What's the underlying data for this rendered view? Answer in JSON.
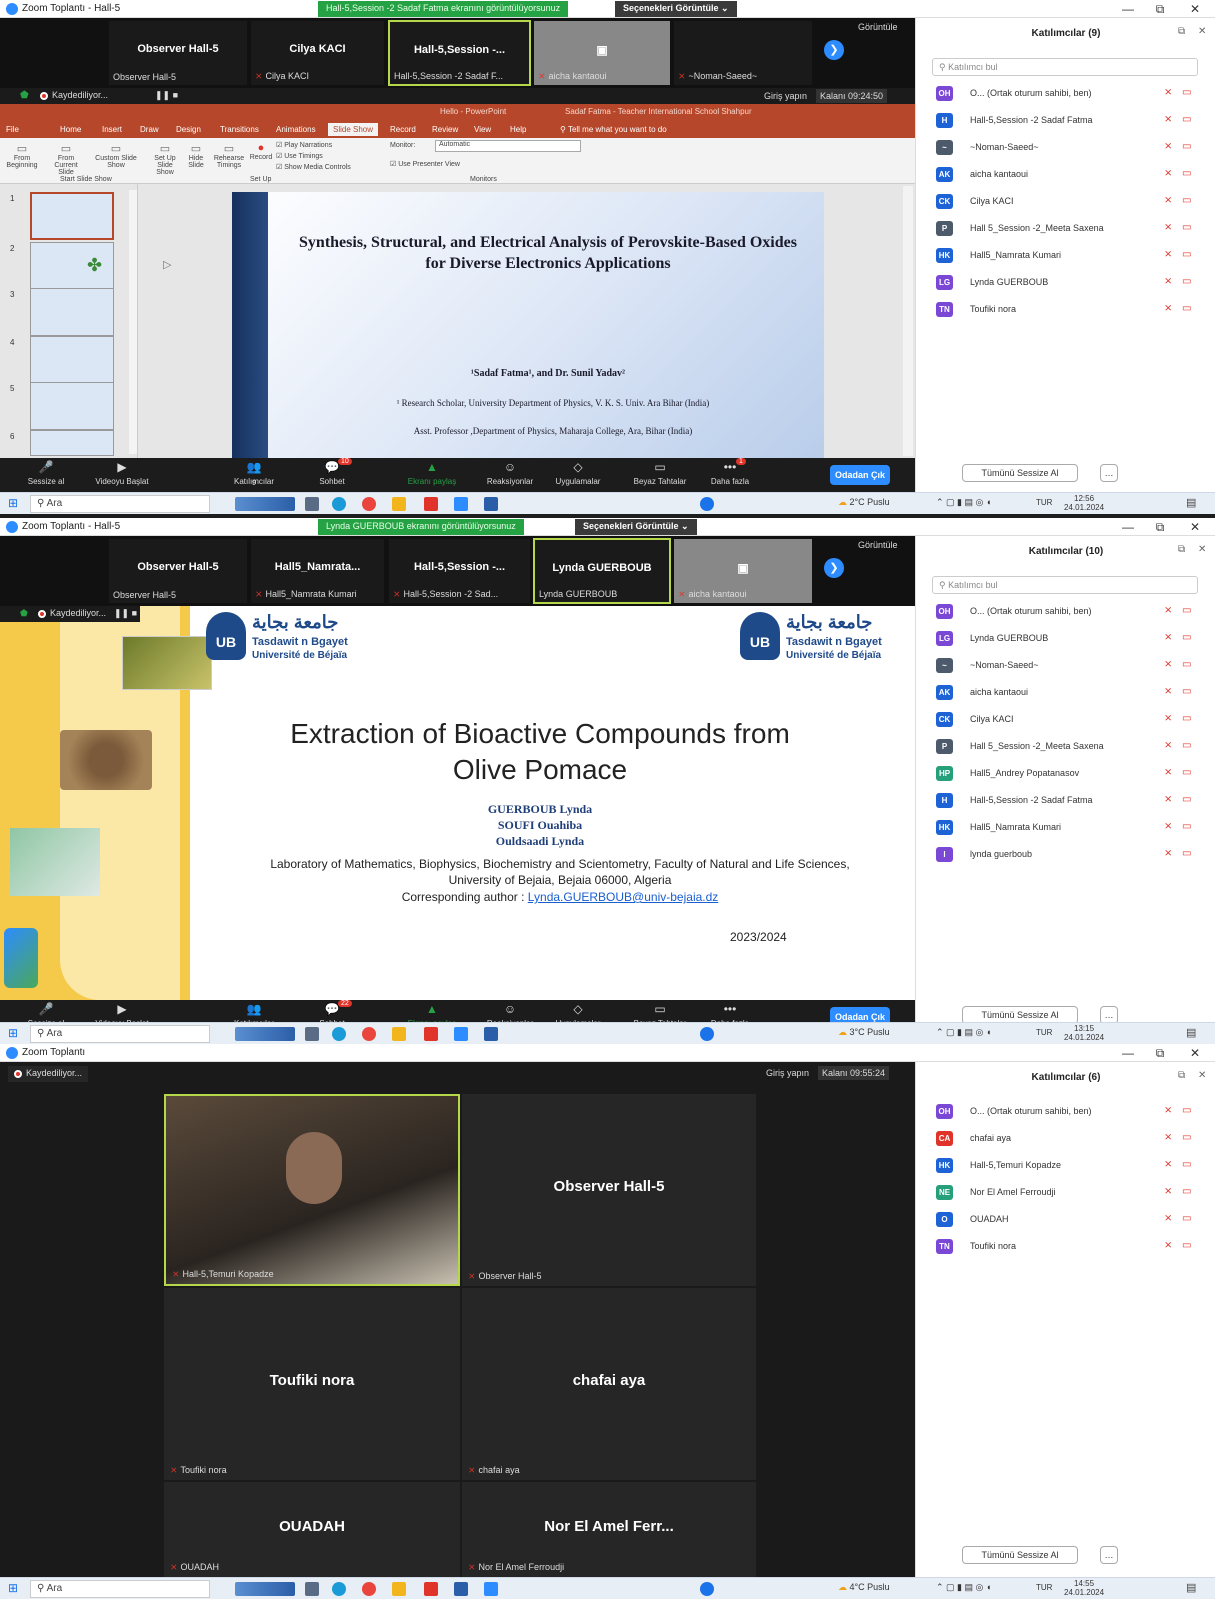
{
  "common": {
    "minimize": "—",
    "restore": "⧉",
    "close": "✕",
    "view_label": "Görüntüle",
    "next_arrow": "❯",
    "mic_off": "🎙̸",
    "options": "Seçenekleri Görüntüle  ⌄",
    "mute_all": "Tümünü Sessize Al",
    "more": "…",
    "search_placeholder": "Katılımcı bul",
    "search_icon": "search-icon",
    "sign_in": "Giriş yapın",
    "taskbar_search": "Ara",
    "lang": "TUR",
    "leave": "Odadan Çık",
    "colors": {
      "zoom_blue": "#2d8cff",
      "share_green": "#25a244",
      "rec_red": "#e0342a",
      "ppt_orange": "#b7472a",
      "active_border": "#b4d84a"
    }
  },
  "toolbar": {
    "mute1": "Sessize al",
    "mute2": "Sessize al",
    "video": "Videoyu Başlat",
    "participants": "Katılımcılar",
    "chat": "Sohbet",
    "share": "Ekranı paylaş",
    "reactions": "Reaksiyonlar",
    "apps": "Uygulamalar",
    "whiteboards": "Beyaz Tahtalar",
    "more": "Daha fazla"
  },
  "s1": {
    "window_title": "Zoom Toplantı - Hall-5",
    "share_banner": "Hall-5,Session -2 Sadaf Fatma ekranını görüntülüyorsunuz",
    "tiles": [
      {
        "name": "Observer Hall-5",
        "label": "Observer Hall-5"
      },
      {
        "name": "Cilya KACI",
        "label": "Cilya KACI"
      },
      {
        "name": "Hall-5,Session -...",
        "label": "Hall-5,Session -2 Sadaf F..."
      },
      {
        "name": "",
        "label": "aicha kantaoui"
      },
      {
        "name": "",
        "label": "~Noman-Saeed~"
      }
    ],
    "recording": "Kaydediliyor...",
    "pause_stop": "❚❚  ■",
    "remaining": "Kalanı 09:24:50",
    "ppt_title": "Hello - PowerPoint",
    "ppt_user": "Sadaf Fatma - Teacher International School Shahpur",
    "ppt_tabs": [
      "File",
      "Home",
      "Insert",
      "Draw",
      "Design",
      "Transitions",
      "Animations",
      "Slide Show",
      "Record",
      "Review",
      "View",
      "Help"
    ],
    "tell_me": "Tell me what you want to do",
    "ribbon_groups": [
      {
        "label": "From Beginning",
        "group": ""
      },
      {
        "label": "From Current Slide",
        "group": "Start Slide Show"
      },
      {
        "label": "Custom Slide Show",
        "group": ""
      },
      {
        "label": "Set Up Slide Show",
        "group": ""
      },
      {
        "label": "Hide Slide",
        "group": "Set Up"
      },
      {
        "label": "Rehearse Timings",
        "group": ""
      },
      {
        "label": "Record",
        "group": ""
      }
    ],
    "ribbon_checks": [
      "Play Narrations",
      "Use Timings",
      "Show Media Controls"
    ],
    "monitor_label": "Monitor:",
    "monitor_value": "Automatic",
    "presenter_view": "Use Presenter View",
    "monitors_group": "Monitors",
    "slide_nums": [
      "1",
      "2",
      "3",
      "4",
      "5",
      "6"
    ],
    "slide_title": "Synthesis, Structural, and Electrical Analysis of Perovskite-Based Oxides for Diverse Electronics Applications",
    "slide_authors": "¹Sadaf Fatma¹, and Dr. Sunil Yadav²",
    "slide_aff1": "¹ Research Scholar, University Department of Physics, V. K. S. Univ. Ara Bihar (India)",
    "slide_aff2": "Asst. Professor ,Department of Physics, Maharaja College, Ara, Bihar (India)",
    "participants_count": "9",
    "chat_badge": "10",
    "more_badge": "1",
    "panel_title": "Katılımcılar (9)",
    "participants": [
      {
        "initials": "OH",
        "color": "#7b48d6",
        "name": "O... (Ortak oturum sahibi, ben)"
      },
      {
        "initials": "H",
        "color": "#1e63d6",
        "name": "Hall-5,Session -2 Sadaf Fatma"
      },
      {
        "initials": "~",
        "color": "#4d5a6b",
        "name": "~Noman-Saeed~"
      },
      {
        "initials": "AK",
        "color": "#1e63d6",
        "name": "aicha kantaoui"
      },
      {
        "initials": "CK",
        "color": "#1e63d6",
        "name": "Cilya KACI"
      },
      {
        "initials": "P",
        "color": "#4d5a6b",
        "name": "Hall 5_Session -2_Meeta Saxena"
      },
      {
        "initials": "HK",
        "color": "#1e63d6",
        "name": "Hall5_Namrata Kumari"
      },
      {
        "initials": "LG",
        "color": "#7b48d6",
        "name": "Lynda GUERBOUB"
      },
      {
        "initials": "TN",
        "color": "#7b48d6",
        "name": "Toufiki nora"
      }
    ],
    "weather": "2°C Puslu",
    "time": "12:56",
    "date": "24.01.2024"
  },
  "s2": {
    "window_title": "Zoom Toplantı - Hall-5",
    "share_banner": "Lynda GUERBOUB ekranını görüntülüyorsunuz",
    "tiles": [
      {
        "name": "Observer Hall-5",
        "label": "Observer Hall-5"
      },
      {
        "name": "Hall5_Namrata...",
        "label": "Hall5_Namrata Kumari"
      },
      {
        "name": "Hall-5,Session -...",
        "label": "Hall-5,Session -2 Sad..."
      },
      {
        "name": "Lynda GUERBOUB",
        "label": "Lynda GUERBOUB"
      },
      {
        "name": "",
        "label": "aicha kantaoui"
      }
    ],
    "recording": "Kaydediliyor...",
    "pause_stop": "❚❚  ■",
    "uni_arabic": "جامعة بجاية",
    "uni_kabyle": "Tasdawit n Bgayet",
    "uni_french": "Université de Béjaïa",
    "slide_title": "Extraction of Bioactive Compounds from Olive Pomace",
    "authors": [
      "GUERBOUB Lynda",
      "SOUFI Ouahiba",
      "Ouldsaadi Lynda"
    ],
    "lab": "Laboratory of Mathematics, Biophysics, Biochemistry and Scientometry, Faculty of Natural and Life Sciences, University of Bejaia, Bejaia 06000, Algeria",
    "corresponding_label": "Corresponding author :",
    "email": "Lynda.GUERBOUB@univ-bejaia.dz",
    "year": "2023/2024",
    "participants_count": "10",
    "chat_badge": "22",
    "panel_title": "Katılımcılar (10)",
    "participants": [
      {
        "initials": "OH",
        "color": "#7b48d6",
        "name": "O... (Ortak oturum sahibi, ben)"
      },
      {
        "initials": "LG",
        "color": "#7b48d6",
        "name": "Lynda GUERBOUB"
      },
      {
        "initials": "~",
        "color": "#4d5a6b",
        "name": "~Noman-Saeed~"
      },
      {
        "initials": "AK",
        "color": "#1e63d6",
        "name": "aicha kantaoui"
      },
      {
        "initials": "CK",
        "color": "#1e63d6",
        "name": "Cilya KACI"
      },
      {
        "initials": "P",
        "color": "#4d5a6b",
        "name": "Hall 5_Session -2_Meeta Saxena"
      },
      {
        "initials": "HP",
        "color": "#26a07a",
        "name": "Hall5_Andrey Popatanasov"
      },
      {
        "initials": "H",
        "color": "#1e63d6",
        "name": "Hall-5,Session -2 Sadaf Fatma"
      },
      {
        "initials": "HK",
        "color": "#1e63d6",
        "name": "Hall5_Namrata Kumari"
      },
      {
        "initials": "l",
        "color": "#7b48d6",
        "name": "lynda guerboub"
      }
    ],
    "weather": "3°C Puslu",
    "time": "13:15",
    "date": "24.01.2024"
  },
  "s3": {
    "window_title": "Zoom Toplantı",
    "recording": "Kaydediliyor...",
    "remaining": "Kalanı 09:55:24",
    "tiles": [
      {
        "name": "",
        "label": "Hall-5,Temuri Kopadze"
      },
      {
        "name": "Observer Hall-5",
        "label": "Observer Hall-5"
      },
      {
        "name": "Toufiki nora",
        "label": "Toufiki nora"
      },
      {
        "name": "chafai aya",
        "label": "chafai aya"
      },
      {
        "name": "OUADAH",
        "label": "OUADAH"
      },
      {
        "name": "Nor El Amel Ferr...",
        "label": "Nor El Amel Ferroudji"
      }
    ],
    "panel_title": "Katılımcılar (6)",
    "participants": [
      {
        "initials": "OH",
        "color": "#7b48d6",
        "name": "O... (Ortak oturum sahibi, ben)"
      },
      {
        "initials": "CA",
        "color": "#e0342a",
        "name": "chafai aya"
      },
      {
        "initials": "HK",
        "color": "#1e63d6",
        "name": "Hall-5,Temuri Kopadze"
      },
      {
        "initials": "NE",
        "color": "#26a07a",
        "name": "Nor El Amel Ferroudji"
      },
      {
        "initials": "O",
        "color": "#1e63d6",
        "name": "OUADAH"
      },
      {
        "initials": "TN",
        "color": "#7b48d6",
        "name": "Toufiki nora"
      }
    ],
    "weather": "4°C Puslu",
    "time": "14:55",
    "date": "24.01.2024"
  }
}
